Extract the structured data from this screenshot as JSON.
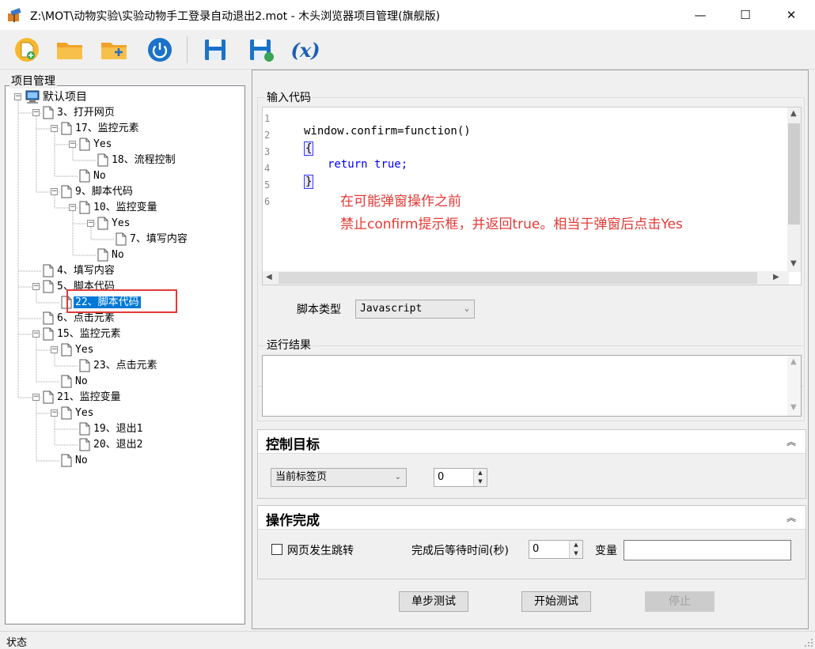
{
  "window": {
    "title": "Z:\\MOT\\动物实验\\实验动物手工登录自动退出2.mot - 木头浏览器项目管理(旗舰版)",
    "minimize": "—",
    "maximize": "☐",
    "close": "✕"
  },
  "toolbar": {
    "buttons": [
      "new-project",
      "open-folder",
      "add-folder",
      "power",
      "save",
      "save-as",
      "variable"
    ],
    "variable_label": "(x)"
  },
  "left_panel": {
    "caption": "项目管理",
    "highlight_color": "#e53935",
    "tree": [
      {
        "label": "默认项目",
        "type": "root",
        "expanded": true
      },
      {
        "label": "3、打开网页",
        "type": "doc",
        "expanded": true
      },
      {
        "label": "17、监控元素",
        "type": "doc",
        "expanded": true
      },
      {
        "label": "Yes",
        "type": "doc",
        "expanded": true
      },
      {
        "label": "18、流程控制",
        "type": "doc"
      },
      {
        "label": "No",
        "type": "doc"
      },
      {
        "label": "9、脚本代码",
        "type": "doc",
        "expanded": true
      },
      {
        "label": "10、监控变量",
        "type": "doc",
        "expanded": true
      },
      {
        "label": "Yes",
        "type": "doc",
        "expanded": true
      },
      {
        "label": "7、填写内容",
        "type": "doc"
      },
      {
        "label": "No",
        "type": "doc"
      },
      {
        "label": "4、填写内容",
        "type": "doc"
      },
      {
        "label": "5、脚本代码",
        "type": "doc",
        "expanded": true
      },
      {
        "label": "22、脚本代码",
        "type": "doc",
        "selected": true
      },
      {
        "label": "6、点击元素",
        "type": "doc"
      },
      {
        "label": "15、监控元素",
        "type": "doc",
        "expanded": true
      },
      {
        "label": "Yes",
        "type": "doc",
        "expanded": true
      },
      {
        "label": "23、点击元素",
        "type": "doc"
      },
      {
        "label": "No",
        "type": "doc"
      },
      {
        "label": "21、监控变量",
        "type": "doc",
        "expanded": true
      },
      {
        "label": "Yes",
        "type": "doc",
        "expanded": true
      },
      {
        "label": "19、退出1",
        "type": "doc"
      },
      {
        "label": "20、退出2",
        "type": "doc"
      },
      {
        "label": "No",
        "type": "doc"
      }
    ]
  },
  "code_section": {
    "caption": "输入代码",
    "line_numbers": [
      "1",
      "2",
      "3",
      "4",
      "5",
      "6"
    ],
    "line2": "window.confirm=function()",
    "open_brace": "{",
    "line4_kw": "return",
    "line4_val": "true;",
    "close_brace": "}",
    "annotation_1": "在可能弹窗操作之前",
    "annotation_2": "禁止confirm提示框，并返回true。相当于弹窗后点击Yes",
    "annotation_color": "#e53935",
    "script_type_label": "脚本类型",
    "script_type_value": "Javascript"
  },
  "result_section": {
    "caption": "运行结果"
  },
  "control_target": {
    "title": "控制目标",
    "tab_select": "当前标签页",
    "index_value": "0"
  },
  "operation_done": {
    "title": "操作完成",
    "checkbox_label": "网页发生跳转",
    "checked": false,
    "wait_label": "完成后等待时间(秒)",
    "wait_value": "0",
    "variable_label": "变量",
    "variable_value": ""
  },
  "buttons": {
    "step_test": "单步测试",
    "start_test": "开始测试",
    "stop": "停止"
  },
  "status": {
    "text": "状态"
  }
}
